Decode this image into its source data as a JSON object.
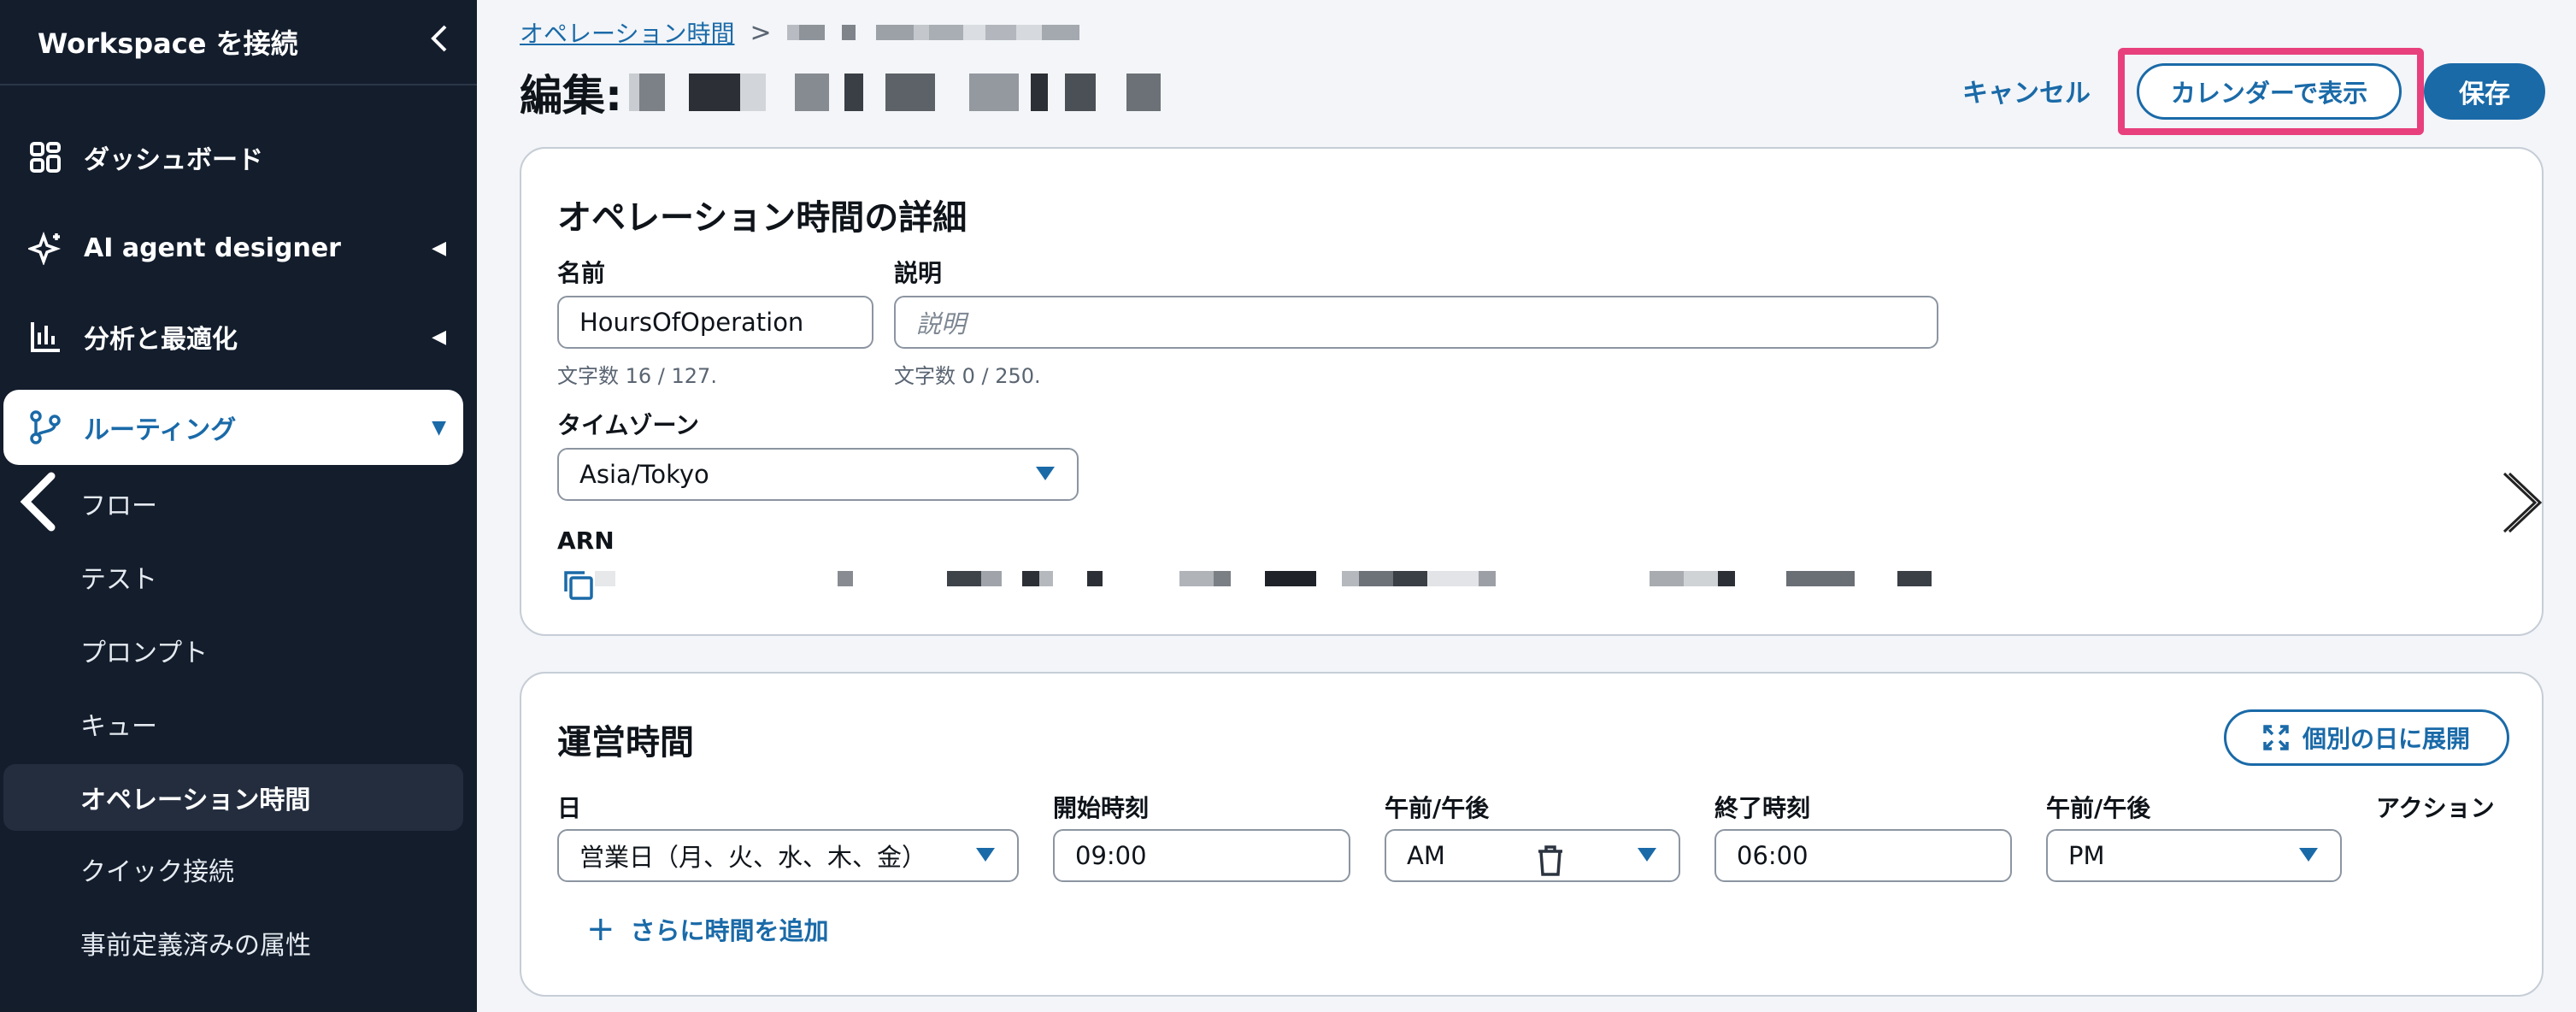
{
  "sidebar": {
    "title": "Workspace を接続",
    "collapse_icon": "chevron-left-icon",
    "items": [
      {
        "label": "ダッシュボード",
        "icon": "dashboard-grid-icon"
      },
      {
        "label": "AI agent designer",
        "icon": "sparkle-icon"
      },
      {
        "label": "分析と最適化",
        "icon": "bar-chart-icon"
      },
      {
        "label": "ルーティング",
        "icon": "routing-branch-icon"
      }
    ],
    "sub_items": [
      {
        "label": "フロー"
      },
      {
        "label": "テスト"
      },
      {
        "label": "プロンプト"
      },
      {
        "label": "キュー"
      },
      {
        "label": "オペレーション時間"
      },
      {
        "label": "クイック接続"
      },
      {
        "label": "事前定義済みの属性"
      }
    ]
  },
  "breadcrumb": {
    "link": "オペレーション時間"
  },
  "header": {
    "title_prefix": "編集:",
    "cancel": "キャンセル",
    "calendar": "カレンダーで表示",
    "save": "保存"
  },
  "details": {
    "heading": "オペレーション時間の詳細",
    "name_label": "名前",
    "name_value": "HoursOfOperation",
    "name_hint": "文字数 16 / 127.",
    "desc_label": "説明",
    "desc_placeholder": "説明",
    "desc_hint": "文字数 0 / 250.",
    "tz_label": "タイムゾーン",
    "tz_value": "Asia/Tokyo",
    "arn_label": "ARN"
  },
  "hours": {
    "heading": "運営時間",
    "expand": "個別の日に展開",
    "col_day": "日",
    "col_start": "開始時刻",
    "col_ampm1": "午前/午後",
    "col_end": "終了時刻",
    "col_ampm2": "午前/午後",
    "col_action": "アクション",
    "day_value": "営業日（月、火、水、木、金）",
    "start_value": "09:00",
    "start_ampm": "AM",
    "end_value": "06:00",
    "end_ampm": "PM",
    "add_more": "さらに時間を追加"
  },
  "colors": {
    "sidebar_bg": "#131d2c",
    "accent": "#1a6aa8",
    "highlight": "#e8407c"
  }
}
